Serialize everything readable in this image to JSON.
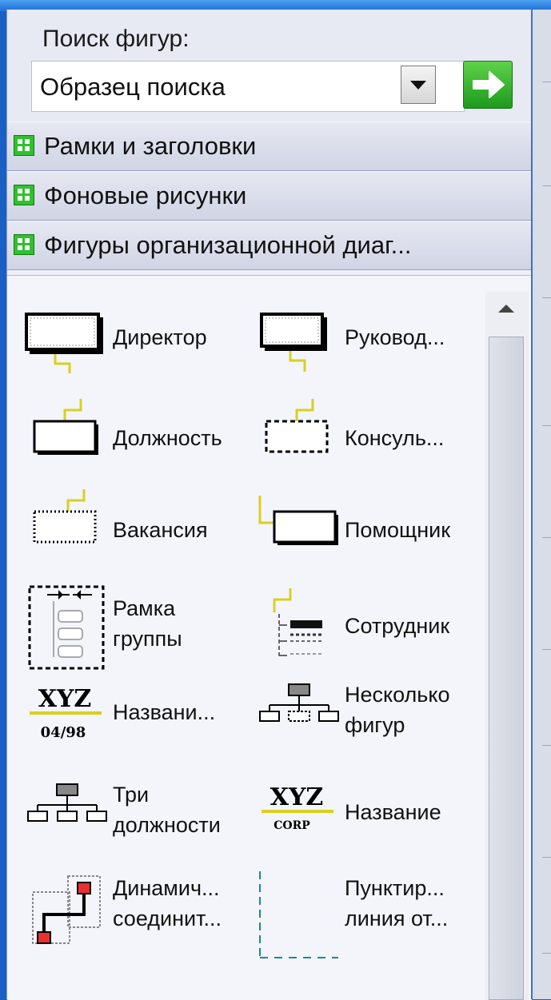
{
  "search": {
    "label": "Поиск фигур:",
    "value": "Образец поиска"
  },
  "stencils": [
    {
      "label": "Рамки и заголовки"
    },
    {
      "label": "Фоновые рисунки"
    },
    {
      "label": "Фигуры организационной диаг..."
    }
  ],
  "shapes": [
    {
      "label": "Директор",
      "icon": "executive-shape-icon"
    },
    {
      "label": "Руковод...",
      "icon": "manager-shape-icon"
    },
    {
      "label": "Должность",
      "icon": "position-shape-icon"
    },
    {
      "label": "Консуль...",
      "icon": "consultant-shape-icon"
    },
    {
      "label": "Вакансия",
      "icon": "vacancy-shape-icon"
    },
    {
      "label": "Помощник",
      "icon": "assistant-shape-icon"
    },
    {
      "label": "Рамка\nгруппы",
      "icon": "team-frame-shape-icon"
    },
    {
      "label": "Сотрудник",
      "icon": "staff-shape-icon"
    },
    {
      "label": "Названи...",
      "icon": "title-date-shape-icon"
    },
    {
      "label": "Несколько\nфигур",
      "icon": "multiple-shapes-icon"
    },
    {
      "label": "Три\nдолжности",
      "icon": "three-positions-icon"
    },
    {
      "label": "Название",
      "icon": "name-corp-shape-icon"
    },
    {
      "label": "Динамич...\nсоединит...",
      "icon": "dynamic-connector-icon"
    },
    {
      "label": "Пунктир...\nлиния от...",
      "icon": "dotted-line-icon"
    }
  ],
  "icon_text": {
    "xyz": "XYZ",
    "date": "04/98",
    "corp": "CORP"
  }
}
